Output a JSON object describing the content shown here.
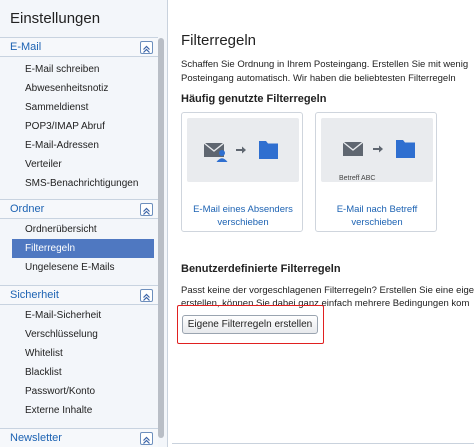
{
  "sidebar": {
    "title": "Einstellungen",
    "sections": [
      {
        "label": "E-Mail",
        "items": [
          "E-Mail schreiben",
          "Abwesenheitsnotiz",
          "Sammeldienst",
          "POP3/IMAP Abruf",
          "E-Mail-Adressen",
          "Verteiler",
          "SMS-Benachrichtigungen"
        ]
      },
      {
        "label": "Ordner",
        "items": [
          "Ordnerübersicht",
          "Filterregeln",
          "Ungelesene E-Mails"
        ],
        "active_item": "Filterregeln"
      },
      {
        "label": "Sicherheit",
        "items": [
          "E-Mail-Sicherheit",
          "Verschlüsselung",
          "Whitelist",
          "Blacklist",
          "Passwort/Konto",
          "Externe Inhalte"
        ]
      },
      {
        "label": "Newsletter",
        "items": []
      }
    ],
    "collapse_icon": "chevron-up-double-icon"
  },
  "main": {
    "title": "Filterregeln",
    "intro_lines": [
      "Schaffen Sie Ordnung in Ihrem Posteingang. Erstellen Sie mit wenig",
      "Posteingang automatisch. Wir haben die beliebtesten Filterregeln"
    ],
    "common_title": "Häufig genutzte Filterregeln",
    "cards": [
      {
        "label": "E-Mail eines Absenders verschieben",
        "icons": [
          "envelope-icon",
          "person-icon",
          "arrow-right-icon",
          "folder-icon"
        ]
      },
      {
        "label": "E-Mail nach Betreff verschieben",
        "sublabel": "Betreff ABC",
        "icons": [
          "envelope-icon",
          "arrow-right-icon",
          "folder-icon"
        ]
      }
    ],
    "custom_title": "Benutzerdefinierte Filterregeln",
    "custom_lines": [
      "Passt keine der vorgeschlagenen Filterregeln? Erstellen Sie eine eige",
      "erstellen, können Sie dabei ganz einfach mehrere Bedingungen kom"
    ],
    "create_button": "Eigene Filterregeln erstellen"
  },
  "colors": {
    "accent": "#4f78c1",
    "link": "#1d63b3",
    "highlight": "#e02020",
    "icon_gray": "#5f6670",
    "folder_blue": "#2f6fd0"
  }
}
